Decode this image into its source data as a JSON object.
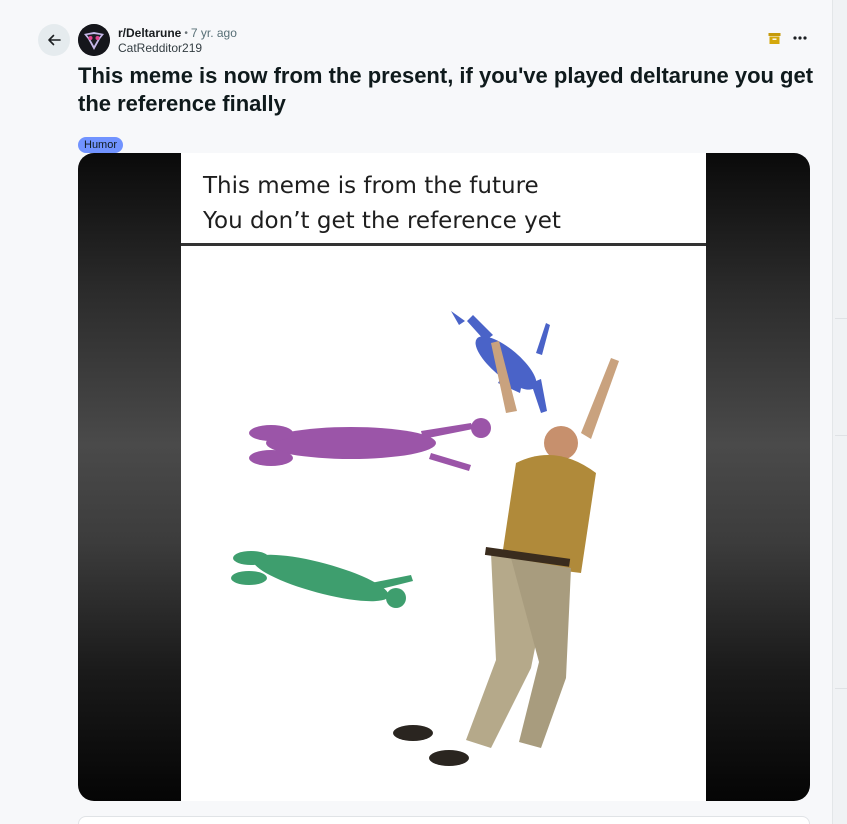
{
  "post": {
    "subreddit": "r/Deltarune",
    "separator": "•",
    "age": "7 yr. ago",
    "author": "CatRedditor219",
    "title": "This meme is now from the present, if you've played deltarune you get the reference finally",
    "flair": "Humor",
    "flair_color": "#7193ff"
  },
  "meme": {
    "caption_line1": "This meme is from the future",
    "caption_line2": "You don’t get the reference yet"
  },
  "icons": {
    "back": "arrow-left-icon",
    "archive": "archive-icon",
    "more": "more-horizontal-icon"
  }
}
